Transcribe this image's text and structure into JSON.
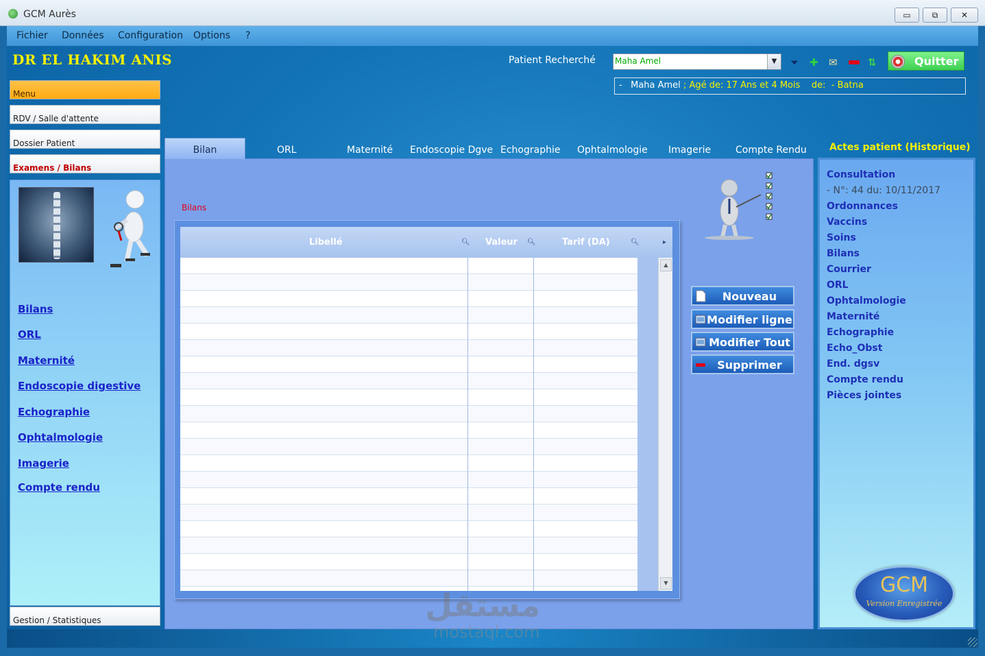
{
  "window": {
    "title": "GCM Aurès",
    "controls": {
      "minimize": "▭",
      "restore": "⧉",
      "close": "✕"
    }
  },
  "menu": {
    "items": [
      "Fichier",
      "Données",
      "Configuration",
      "Options",
      "?"
    ]
  },
  "header": {
    "doctor": "DR  EL HAKIM ANIS",
    "patient_label": "Patient Recherché",
    "patient_value": "Maha Amel",
    "quit_label": "Quitter",
    "patient_info": {
      "dash": "-",
      "name": "Maha Amel",
      "age": "; Agé de: 17 Ans et 4 Mois",
      "from_label": "de:",
      "city": "- Batna"
    },
    "tool_icons": [
      "filter-icon",
      "add-icon",
      "envelope-icon",
      "remove-icon",
      "refresh-icon"
    ]
  },
  "sidebar": {
    "buttons": [
      "Menu",
      "RDV / Salle d'attente",
      "Dossier Patient",
      "Examens / Bilans"
    ],
    "links": [
      "Bilans",
      "ORL",
      "Maternité",
      "Endoscopie digestive",
      "Echographie",
      "Ophtalmologie",
      "Imagerie",
      "Compte rendu"
    ],
    "bottom_button": "Gestion / Statistiques"
  },
  "tabs": [
    "Bilan",
    "ORL",
    "Maternité",
    "Endoscopie Dgve",
    "Echographie",
    "Ophtalmologie",
    "Imagerie",
    "Compte Rendu"
  ],
  "content": {
    "section_label": "Bilans",
    "grid": {
      "columns": [
        "Libellé",
        "Valeur",
        "Tarif (DA)"
      ],
      "rows": []
    },
    "actions": [
      "Nouveau",
      "Modifier ligne",
      "Modifier Tout",
      "Supprimer"
    ]
  },
  "history": {
    "title": "Actes patient (Historique)",
    "items": [
      "Consultation",
      "Ordonnances",
      "Vaccins",
      "Soins",
      "Bilans",
      "Courrier",
      "ORL",
      "Ophtalmologie",
      "Maternité",
      "Echographie",
      "Echo_Obst",
      "End. dgsv",
      "Compte rendu",
      "Pièces jointes"
    ],
    "consultation_detail": "- N°: 44 du: 10/11/2017"
  },
  "logo": {
    "text": "GCM",
    "subtitle": "Version Enregistrée"
  },
  "watermark": {
    "arabic": "مستقل",
    "latin": "mostaql.com"
  },
  "colors": {
    "background": "#1273b6",
    "accent_yellow": "#f5f000",
    "menu_active": "#ffab10",
    "link_blue": "#1a22c8",
    "quit_green": "#3ed052",
    "content_panel": "#7aa1ea"
  }
}
